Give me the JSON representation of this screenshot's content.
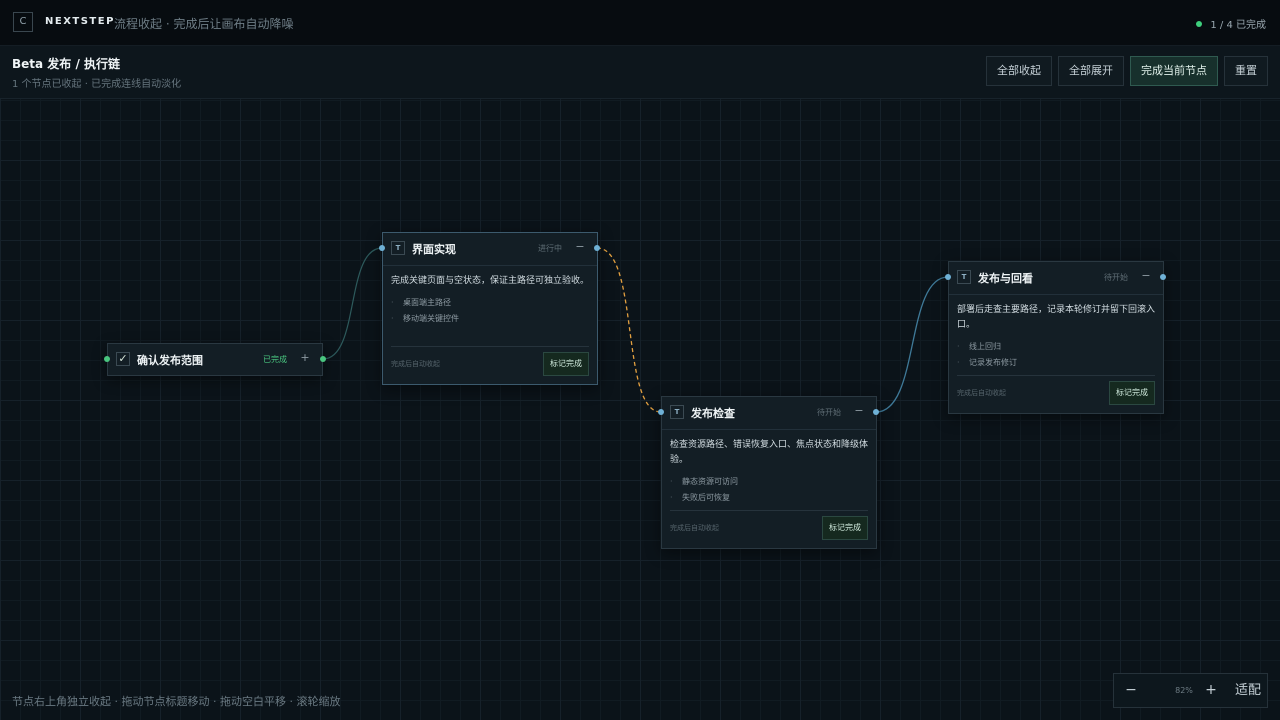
{
  "topbar": {
    "logo": "C",
    "brand": "NEXTSTEP",
    "tagline": "流程收起 · 完成后让画布自动降噪",
    "progress": "1 / 4 已完成"
  },
  "header": {
    "title": "Beta 发布 / 执行链",
    "subtitle": "1 个节点已收起 · 已完成连线自动淡化",
    "buttons": {
      "collapse_all": "全部收起",
      "expand_all": "全部展开",
      "complete_current": "完成当前节点",
      "reset": "重置"
    }
  },
  "nodes": {
    "n1": {
      "title": "确认发布范围",
      "status": "已完成",
      "toggle": "+",
      "icon": "✓"
    },
    "n2": {
      "title": "界面实现",
      "status": "进行中",
      "toggle": "−",
      "icon": "T",
      "desc": "完成关键页面与空状态，保证主路径可独立验收。",
      "items": [
        "桌面端主路径",
        "移动端关键控件"
      ],
      "foot": "完成后自动收起",
      "button": "标记完成"
    },
    "n3": {
      "title": "发布检查",
      "status": "待开始",
      "toggle": "−",
      "icon": "T",
      "desc": "检查资源路径、错误恢复入口、焦点状态和降级体验。",
      "items": [
        "静态资源可访问",
        "失败后可恢复"
      ],
      "foot": "完成后自动收起",
      "button": "标记完成"
    },
    "n4": {
      "title": "发布与回看",
      "status": "待开始",
      "toggle": "−",
      "icon": "T",
      "desc": "部署后走查主要路径，记录本轮修订并留下回滚入口。",
      "items": [
        "线上回归",
        "记录发布修订"
      ],
      "foot": "完成后自动收起",
      "button": "标记完成"
    }
  },
  "colors": {
    "done": "#49c57f",
    "active_edge": "#e3a040",
    "edge": "#3f7a99",
    "port": "#6fb1d6"
  },
  "footer": {
    "hint": "节点右上角独立收起 · 拖动节点标题移动 · 拖动空白平移 · 滚轮缩放"
  },
  "zoom": {
    "minus": "−",
    "level": "82%",
    "plus": "+",
    "fit": "适配"
  }
}
